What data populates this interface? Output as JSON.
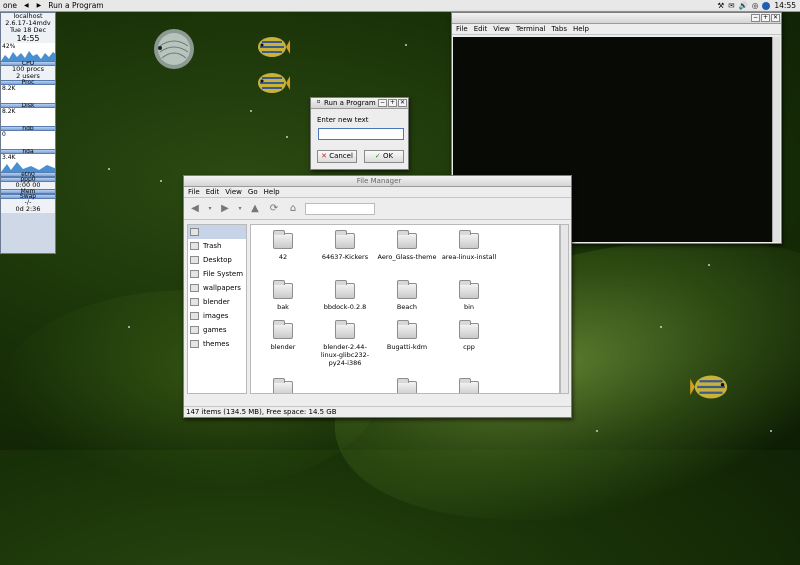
{
  "topbar": {
    "menu_label": "one",
    "task_label": "Run a Program",
    "clock": "14:55"
  },
  "gkrellm": {
    "host": "localhost",
    "kernel": "2.6.17-14mdv",
    "date": "Tue 18 Dec",
    "time": "14:55",
    "cpu_pct": "42%",
    "cpu_label": "CPU",
    "procs": "100 procs",
    "users": "2 users",
    "proc_label": "Proc",
    "proc_val": "8.2K",
    "disk_label": "Disk",
    "disk_val": "8.2K",
    "hdb_label": "hdb",
    "hdb_val": "0",
    "hda_label": "hda",
    "hda_val": "3.4K",
    "eth_label": "eth0",
    "ppp_label": "ppp0",
    "ppp_time": "0:00",
    "ppp_count": "00",
    "mem_label": "Mem",
    "swap_label": "Swap",
    "swap_val": "-/-",
    "uptime": "0d 2:36"
  },
  "terminal": {
    "menu": [
      "File",
      "Edit",
      "View",
      "Terminal",
      "Tabs",
      "Help"
    ]
  },
  "run_dialog": {
    "title": "Run a Program",
    "label": "Enter new text",
    "input_value": "",
    "cancel": "Cancel",
    "ok": "OK"
  },
  "file_manager": {
    "title": "File Manager",
    "menu": [
      "File",
      "Edit",
      "View",
      "Go",
      "Help"
    ],
    "sidebar": [
      "Trash",
      "Desktop",
      "File System",
      "wallpapers",
      "blender",
      "images",
      "games",
      "themes"
    ],
    "files": [
      "42",
      "64637-Kickers",
      "Aero_Glass-theme",
      "area-linux-install",
      "bak",
      "bbdock-0.2.8",
      "Beach",
      "bin",
      "blender",
      "blender-2.44-linux-glibc232-py24-i386",
      "Bugatti-kdm",
      "cpp"
    ],
    "status": "147 items (134.5 MB), Free space: 14.5 GB"
  },
  "colors": {
    "selection": "#4a78b8",
    "terminal_bg": "#080a06",
    "desktop": "#1a3308"
  }
}
